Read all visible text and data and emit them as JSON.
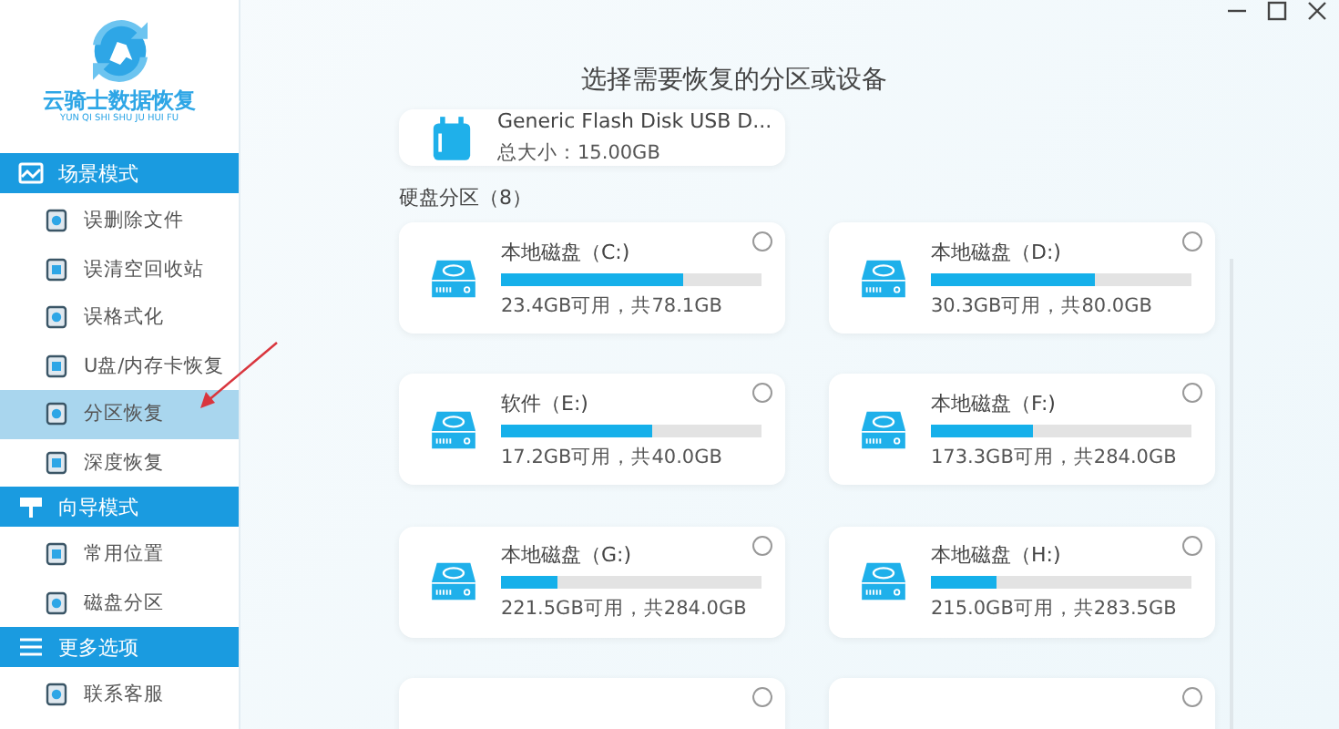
{
  "logo": {
    "name": "云骑士数据恢复",
    "pinyin": "YUN QI SHI SHU JU HUI FU"
  },
  "sidebar": {
    "sections": [
      {
        "title": "场景模式",
        "items": [
          {
            "label": "误删除文件",
            "selected": false
          },
          {
            "label": "误清空回收站",
            "selected": false
          },
          {
            "label": "误格式化",
            "selected": false
          },
          {
            "label": "U盘/内存卡恢复",
            "selected": false
          },
          {
            "label": "分区恢复",
            "selected": true
          },
          {
            "label": "深度恢复",
            "selected": false
          }
        ]
      },
      {
        "title": "向导模式",
        "items": [
          {
            "label": "常用位置",
            "selected": false
          },
          {
            "label": "磁盘分区",
            "selected": false
          }
        ]
      },
      {
        "title": "更多选项",
        "items": [
          {
            "label": "联系客服",
            "selected": false
          }
        ]
      }
    ]
  },
  "title": "选择需要恢复的分区或设备",
  "usb_device": {
    "name": "Generic Flash Disk USB D...",
    "size": "总大小：15.00GB"
  },
  "partitions_heading": "硬盘分区（8）",
  "partitions": [
    {
      "name": "本地磁盘（C:)",
      "level": 0.7,
      "info": "23.4GB可用，共78.1GB",
      "selected": false
    },
    {
      "name": "本地磁盘（D:)",
      "level": 0.63,
      "info": "30.3GB可用，共80.0GB",
      "selected": false
    },
    {
      "name": "软件（E:)",
      "level": 0.58,
      "info": "17.2GB可用，共40.0GB",
      "selected": false
    },
    {
      "name": "本地磁盘（F:)",
      "level": 0.39,
      "info": "173.3GB可用，共284.0GB",
      "selected": false
    },
    {
      "name": "本地磁盘（G:)",
      "level": 0.22,
      "info": "221.5GB可用，共284.0GB",
      "selected": false
    },
    {
      "name": "本地磁盘（H:)",
      "level": 0.25,
      "info": "215.0GB可用，共283.5GB",
      "selected": false
    },
    {
      "selected": false
    },
    {
      "selected": false
    }
  ]
}
